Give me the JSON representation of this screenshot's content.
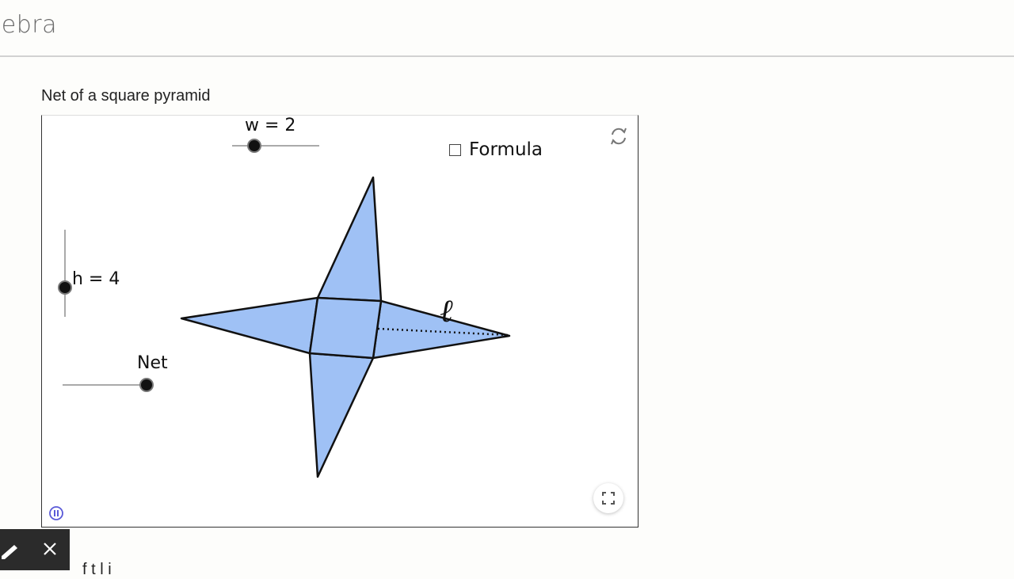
{
  "header": {
    "brand": "Gebra"
  },
  "page": {
    "title": "Net of a square pyramid",
    "next_text": "f   t   l   i"
  },
  "applet": {
    "slider_w": {
      "label": "w = 2",
      "value": 2
    },
    "slider_h": {
      "label": "h = 4",
      "value": 4
    },
    "slider_net": {
      "label": "Net",
      "value": 1
    },
    "formula_checkbox": {
      "label": "Formula",
      "checked": false
    },
    "slant_label": "ℓ",
    "fill_color": "#9fc1f5",
    "icons": {
      "refresh": "refresh-icon",
      "fullscreen": "fullscreen-icon",
      "pause": "pause-icon"
    }
  },
  "toolbar": {
    "icons": [
      "pen-icon",
      "close-icon"
    ]
  }
}
